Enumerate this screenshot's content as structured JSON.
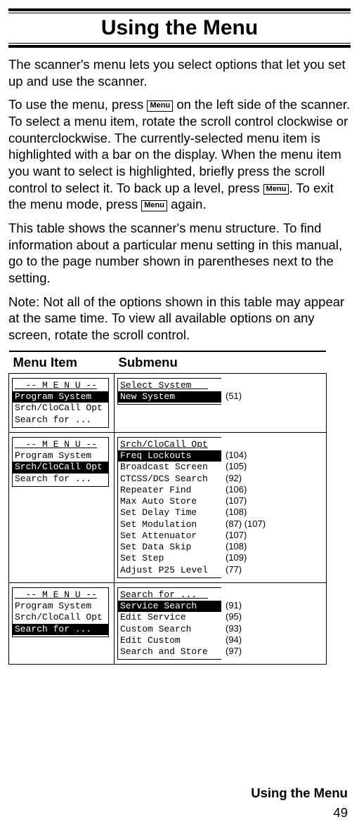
{
  "title": "Using the Menu",
  "menu_label": "Menu",
  "paragraphs": {
    "p1": "The scanner's menu lets you select options that let you set up and use the scanner.",
    "p2a": "To use the menu, press ",
    "p2b": " on the left side of the scanner. To select a menu item, rotate the scroll control clockwise or counterclockwise. The currently-selected menu item is highlighted with a bar on the display. When the menu item you want to select is highlighted, briefly press the scroll control to select it. To back up a level, press ",
    "p2c": ". To exit the menu mode, press ",
    "p2d": " again.",
    "p3": "This table shows the scanner's menu structure. To find information about a particular menu setting in this manual, go to the page number shown in parentheses next to the setting.",
    "p4": "Note: Not all of the options shown in this table may appear at the same time. To view all available options on any screen, rotate the scroll control."
  },
  "table_headers": {
    "col1": "Menu Item",
    "col2": "Submenu"
  },
  "rows": [
    {
      "menu_screen": [
        {
          "text": "  -- M E N U --",
          "ul": true
        },
        {
          "text": "Program System  ",
          "hl": true
        },
        {
          "text": "Srch/CloCall Opt"
        },
        {
          "text": "Search for ..."
        }
      ],
      "sub_screen": [
        {
          "text": "Select System   ",
          "ul": true
        },
        {
          "text": "New System      ",
          "hl": true
        }
      ],
      "page_refs": [
        "",
        "(51)"
      ]
    },
    {
      "menu_screen": [
        {
          "text": "  -- M E N U --",
          "ul": true
        },
        {
          "text": "Program System"
        },
        {
          "text": "Srch/CloCall Opt",
          "hl": true
        },
        {
          "text": "Search for ..."
        }
      ],
      "sub_screen": [
        {
          "text": "Srch/CloCall Opt",
          "ul": true
        },
        {
          "text": "Freq Lockouts   ",
          "hl": true
        },
        {
          "text": "Broadcast Screen"
        },
        {
          "text": "CTCSS/DCS Search"
        },
        {
          "text": "Repeater Find"
        },
        {
          "text": "Max Auto Store"
        },
        {
          "text": "Set Delay Time"
        },
        {
          "text": "Set Modulation"
        },
        {
          "text": "Set Attenuator"
        },
        {
          "text": "Set Data Skip"
        },
        {
          "text": "Set Step"
        },
        {
          "text": "Adjust P25 Level"
        }
      ],
      "page_refs": [
        "",
        "(104)",
        "(105)",
        "(92)",
        "(106)",
        "(107)",
        "(108)",
        "(87) (107)",
        "(107)",
        "(108)",
        "(109)",
        "(77)"
      ]
    },
    {
      "menu_screen": [
        {
          "text": "  -- M E N U --",
          "ul": true
        },
        {
          "text": "Program System"
        },
        {
          "text": "Srch/CloCall Opt"
        },
        {
          "text": "Search for ...  ",
          "hl": true
        }
      ],
      "sub_screen": [
        {
          "text": "Search for ...  ",
          "ul": true
        },
        {
          "text": "Service Search  ",
          "hl": true
        },
        {
          "text": "Edit Service"
        },
        {
          "text": "Custom Search"
        },
        {
          "text": "Edit Custom"
        },
        {
          "text": "Search and Store"
        }
      ],
      "page_refs": [
        "",
        "(91)",
        "(95)",
        "(93)",
        "(94)",
        "(97)"
      ]
    }
  ],
  "footer_title": "Using the Menu",
  "page_number": "49"
}
